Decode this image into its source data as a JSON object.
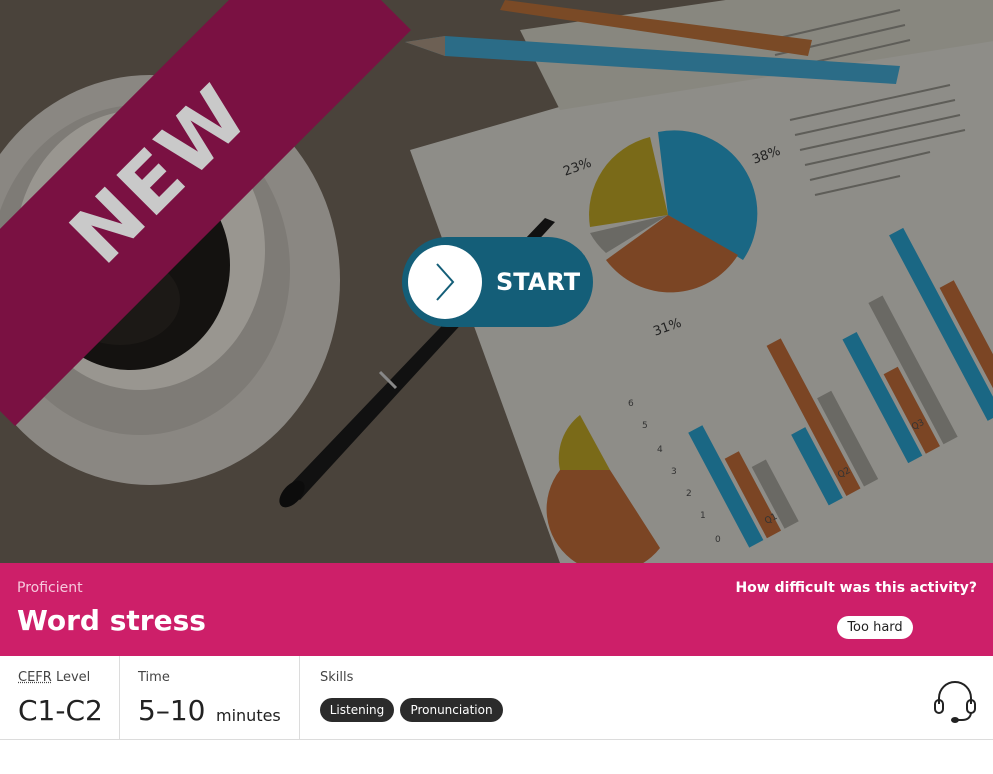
{
  "hero": {
    "ribbon_text": "NEW",
    "start_label": "START",
    "image_labels": {
      "pie_pct_a": "23%",
      "pie_pct_b": "38%",
      "pie_pct_c": "31%",
      "pie_pct_d": "6%",
      "axis_ticks": [
        "0",
        "1",
        "2",
        "3",
        "4",
        "5",
        "6"
      ],
      "quarters": [
        "Q1",
        "Q2",
        "Q3"
      ]
    },
    "colors": {
      "ribbon": "#7a1142",
      "start_button": "#145e78"
    }
  },
  "banner": {
    "level_name": "Proficient",
    "title": "Word stress",
    "rating_question": "How difficult was this activity?",
    "rating_button": "Too hard",
    "color": "#cd1f69"
  },
  "info": {
    "cefr": {
      "abbr": "CEFR",
      "label_suffix": " Level",
      "value": "C1-C2"
    },
    "time": {
      "label": "Time",
      "value": "5–10",
      "unit": "minutes"
    },
    "skills": {
      "label": "Skills",
      "tags": [
        "Listening",
        "Pronunciation"
      ]
    },
    "support_icon": "headset-icon"
  }
}
